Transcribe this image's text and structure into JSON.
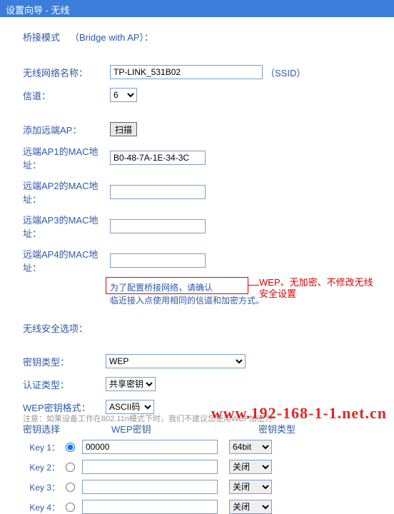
{
  "title": "设置向导 - 无线",
  "bridge_mode_label": "桥接模式",
  "bridge_with_ap": "（Bridge with AP）：",
  "ssid_label": "无线网络名称：",
  "ssid_value": "TP-LINK_531B02",
  "ssid_suffix": "（SSID）",
  "channel_label": "信道：",
  "channel_value": "6",
  "add_ap_label": "添加远端AP：",
  "scan_btn": "扫描",
  "mac1_label": "远端AP1的MAC地址：",
  "mac1_value": "B0-48-7A-1E-34-3C",
  "mac2_label": "远端AP2的MAC地址：",
  "mac3_label": "远端AP3的MAC地址：",
  "mac4_label": "远端AP4的MAC地址：",
  "hint1": "为了配置桥接网络，请确认",
  "hint2": "临近接入点使用相同的信道和加密方式。",
  "security_section": "无线安全选项：",
  "key_type_label": "密钥类型：",
  "key_type_value": "WEP",
  "auth_type_label": "认证类型：",
  "auth_type_value": "共享密钥",
  "wep_format_label": "WEP密钥格式：",
  "wep_format_value": "ASCII码",
  "key_select_head": "密钥选择",
  "wep_key_head": "WEP密钥",
  "key_type_head": "密钥类型",
  "keys": [
    {
      "label": "Key 1：",
      "value": "00000",
      "type": "64bit"
    },
    {
      "label": "Key 2：",
      "value": "",
      "type": "关闭"
    },
    {
      "label": "Key 3：",
      "value": "",
      "type": "关闭"
    },
    {
      "label": "Key 4：",
      "value": "",
      "type": "关闭"
    }
  ],
  "callout": "WEP、无加密、不修改无线安全设置",
  "footnote": "注意：如果设备工作在802.11n模式下时，我们不建议您使用WEP加密方",
  "watermark": "www.192-168-1-1.net.cn"
}
